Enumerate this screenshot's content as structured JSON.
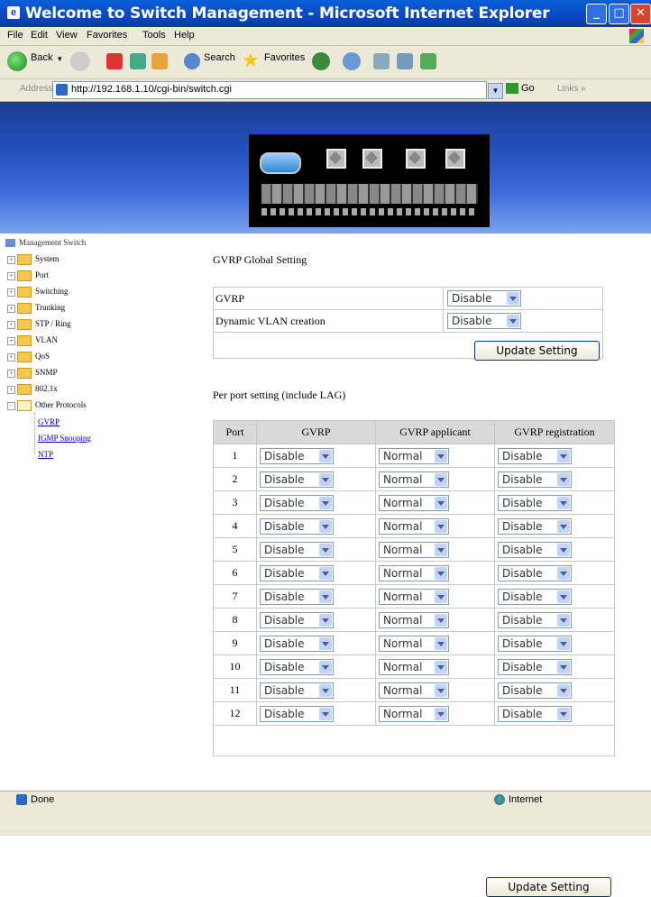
{
  "window": {
    "title": "Welcome to Switch Management - Microsoft Internet Explorer"
  },
  "menu": [
    "File",
    "Edit",
    "View",
    "Favorites",
    "Tools",
    "Help"
  ],
  "toolbar": {
    "back": "Back",
    "search": "Search",
    "favorites": "Favorites"
  },
  "address": {
    "label": "Address",
    "url": "http://192.168.1.10/cgi-bin/switch.cgi",
    "go": "Go",
    "links": "Links"
  },
  "sidebar": {
    "root": "Management Switch",
    "items": [
      "System",
      "Port",
      "Switching",
      "Trunking",
      "STP / Ring",
      "VLAN",
      "QoS",
      "SNMP",
      "802.1x",
      "Other Protocols"
    ],
    "links": [
      "GVRP",
      "IGMP Snooping",
      "NTP"
    ]
  },
  "global": {
    "heading": "GVRP Global Setting",
    "rows": [
      {
        "label": "GVRP",
        "value": "Disable"
      },
      {
        "label": "Dynamic VLAN creation",
        "value": "Disable"
      }
    ],
    "button": "Update Setting"
  },
  "perport": {
    "heading": "Per port setting (include LAG)",
    "columns": [
      "Port",
      "GVRP",
      "GVRP applicant",
      "GVRP registration"
    ],
    "rows": [
      {
        "port": "1",
        "gvrp": "Disable",
        "applicant": "Normal",
        "registration": "Disable"
      },
      {
        "port": "2",
        "gvrp": "Disable",
        "applicant": "Normal",
        "registration": "Disable"
      },
      {
        "port": "3",
        "gvrp": "Disable",
        "applicant": "Normal",
        "registration": "Disable"
      },
      {
        "port": "4",
        "gvrp": "Disable",
        "applicant": "Normal",
        "registration": "Disable"
      },
      {
        "port": "5",
        "gvrp": "Disable",
        "applicant": "Normal",
        "registration": "Disable"
      },
      {
        "port": "6",
        "gvrp": "Disable",
        "applicant": "Normal",
        "registration": "Disable"
      },
      {
        "port": "7",
        "gvrp": "Disable",
        "applicant": "Normal",
        "registration": "Disable"
      },
      {
        "port": "8",
        "gvrp": "Disable",
        "applicant": "Normal",
        "registration": "Disable"
      },
      {
        "port": "9",
        "gvrp": "Disable",
        "applicant": "Normal",
        "registration": "Disable"
      },
      {
        "port": "10",
        "gvrp": "Disable",
        "applicant": "Normal",
        "registration": "Disable"
      },
      {
        "port": "11",
        "gvrp": "Disable",
        "applicant": "Normal",
        "registration": "Disable"
      },
      {
        "port": "12",
        "gvrp": "Disable",
        "applicant": "Normal",
        "registration": "Disable"
      }
    ],
    "button": "Update Setting"
  },
  "status": {
    "left": "Done",
    "zone": "Internet"
  }
}
